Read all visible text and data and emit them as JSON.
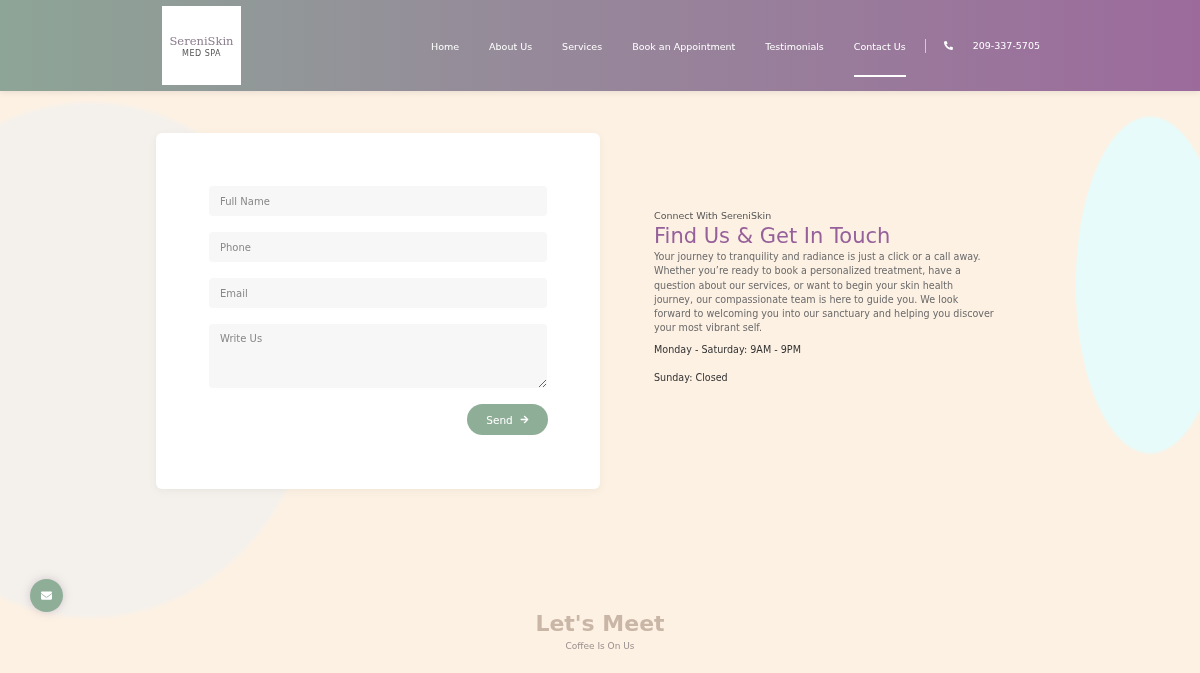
{
  "header": {
    "logo": {
      "name": "SereniSkin",
      "tagline": "MED SPA"
    },
    "nav": [
      {
        "label": "Home",
        "selected": false
      },
      {
        "label": "About Us",
        "selected": false
      },
      {
        "label": "Services",
        "selected": false
      },
      {
        "label": "Book an Appointment",
        "selected": false
      },
      {
        "label": "Testimonials",
        "selected": false
      },
      {
        "label": "Contact Us",
        "selected": true
      }
    ],
    "phone": "209-337-5705"
  },
  "form": {
    "fields": [
      {
        "kind": "input",
        "placeholder": "Full Name"
      },
      {
        "kind": "input",
        "placeholder": "Phone"
      },
      {
        "kind": "input",
        "placeholder": "Email"
      },
      {
        "kind": "textarea",
        "placeholder": "Write Us"
      }
    ],
    "submit": "Send"
  },
  "contact": {
    "eyebrow": "Connect With SereniSkin",
    "title": "Find Us & Get In Touch",
    "body": "Your journey to tranquility and radiance is just a click or a call away. Whether you’re ready to book a personalized treatment, have a question about our services, or want to begin your skin health journey, our compassionate team is here to guide you. We look forward to welcoming you into our sanctuary and helping you discover your most vibrant self.",
    "hours": [
      "Monday - Saturday: 9AM - 9PM",
      "Sunday: Closed"
    ]
  },
  "next_section": {
    "title": "Let's Meet",
    "subtitle": "Coffee Is On Us"
  }
}
